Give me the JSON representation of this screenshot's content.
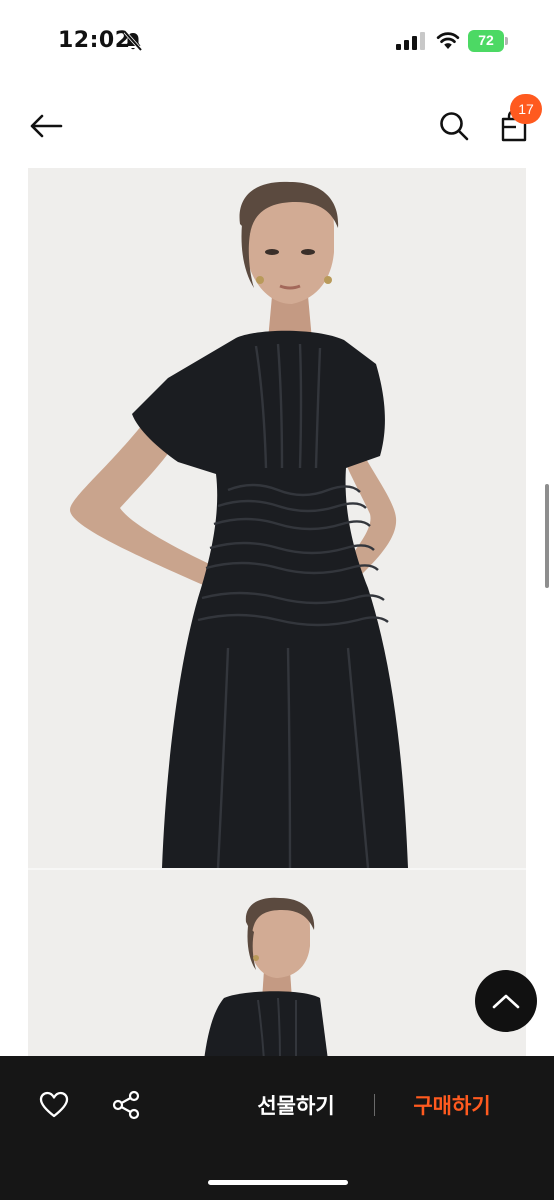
{
  "status_bar": {
    "time": "12:02",
    "battery": "72",
    "icons": [
      "bell-off-icon",
      "signal-icon",
      "wifi-icon",
      "battery-icon"
    ]
  },
  "header": {
    "icons": [
      "back-arrow-icon",
      "search-icon",
      "shopping-bag-icon"
    ],
    "cart_count": "17"
  },
  "product": {
    "images": [
      "black-shirred-dress-model-1",
      "black-shirred-dress-model-2"
    ]
  },
  "bottom_bar": {
    "gift_label": "선물하기",
    "buy_label": "구매하기",
    "icons": [
      "heart-icon",
      "share-icon",
      "chevron-up-icon"
    ]
  },
  "colors": {
    "accent": "#ff5a1f",
    "bottom_bar_bg": "#161616",
    "image_bg": "#efeeec",
    "battery": "#4cd964"
  }
}
